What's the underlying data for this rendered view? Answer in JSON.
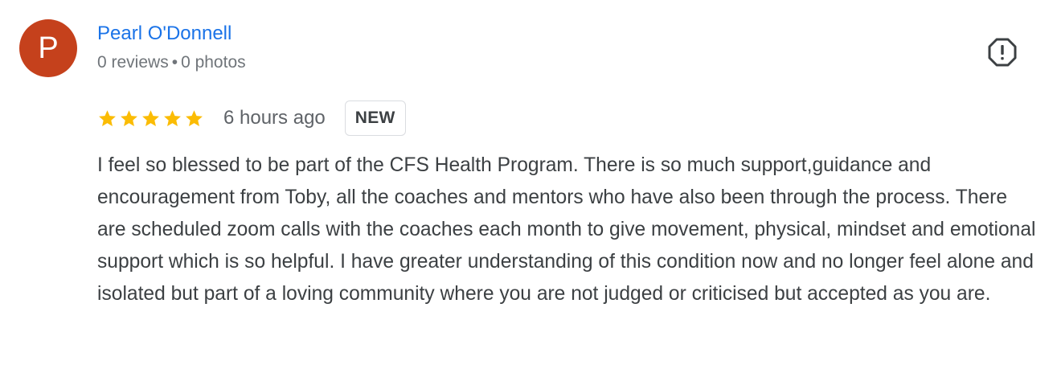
{
  "reviewer": {
    "avatar_letter": "P",
    "avatar_color": "#c5411c",
    "name": "Pearl O'Donnell",
    "reviews_count": "0 reviews",
    "separator": "•",
    "photos_count": "0 photos"
  },
  "rating": {
    "stars": 5,
    "max_stars": 5,
    "star_color": "#fbbc04"
  },
  "time_ago": "6 hours ago",
  "badge": "NEW",
  "review_text": "I feel so blessed to be part of the CFS Health Program. There is so much support,guidance and encouragement from Toby, all the coaches and mentors who have also been through the process. There are scheduled zoom calls with the coaches each month to give movement, physical, mindset and emotional support which is so helpful. I have greater understanding of this condition now and no longer feel alone and isolated but part of a loving community where you are not judged or criticised but accepted as you are.",
  "icons": {
    "report": "report-icon",
    "star": "star-icon"
  },
  "colors": {
    "name_link": "#1a73e8",
    "meta_text": "#70757a",
    "body_text": "#3c4043"
  }
}
